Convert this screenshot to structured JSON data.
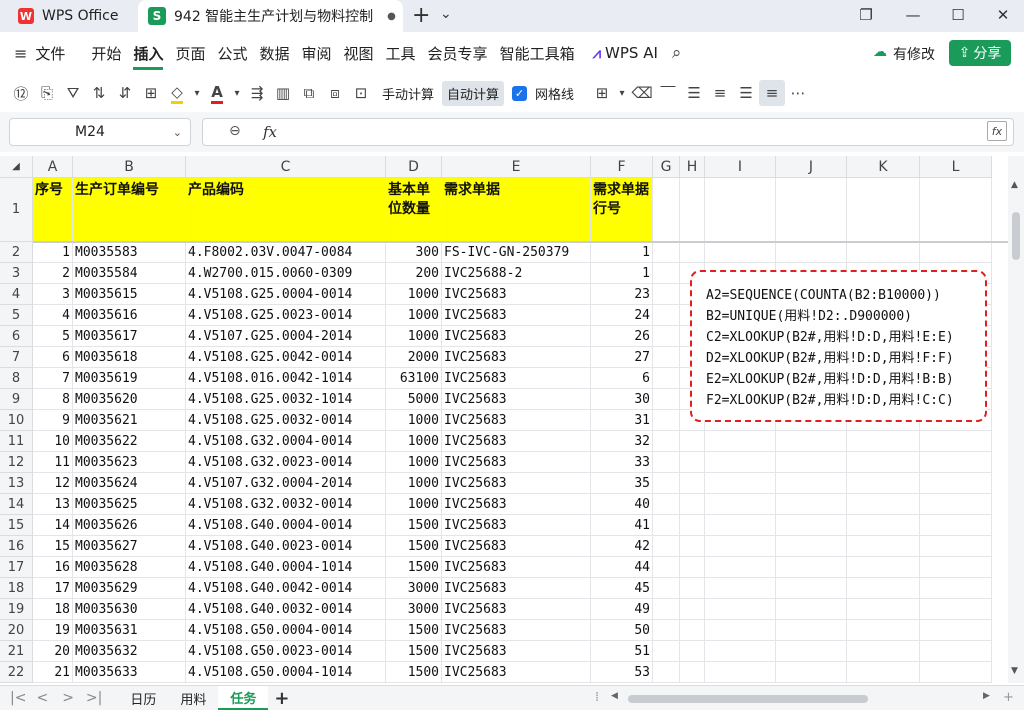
{
  "app": {
    "tab_wps": "WPS Office",
    "tab_doc": "942 智能主生产计划与物料控制",
    "tab_doc_logo": "S",
    "tab_wps_logo": "W",
    "unsaved_dot": "●",
    "new_tab": "+",
    "tab_menu": "⌄"
  },
  "menu": {
    "file": "文件",
    "items": [
      "开始",
      "插入",
      "页面",
      "公式",
      "数据",
      "审阅",
      "视图",
      "工具",
      "会员专享",
      "智能工具箱"
    ],
    "ai": "WPS AI",
    "modify": "有修改",
    "share": "分享"
  },
  "toolbar": {
    "manual_calc": "手动计算",
    "auto_calc": "自动计算",
    "gridlines": "网格线"
  },
  "formula": {
    "name_box": "M24",
    "fx": "fx",
    "value": ""
  },
  "columns": [
    "A",
    "B",
    "C",
    "D",
    "E",
    "F",
    "G",
    "H",
    "I",
    "J",
    "K",
    "L"
  ],
  "header_row": {
    "row": "1",
    "a": "序号",
    "b": "生产订单编号",
    "c": "产品编码",
    "d": "基本单位数量",
    "e": "需求单据",
    "f": "需求单据行号"
  },
  "rows": [
    {
      "r": "2",
      "a": "1",
      "b": "M0035583",
      "c": "4.F8002.03V.0047-0084",
      "d": "300",
      "e": "FS-IVC-GN-250379",
      "f": "1"
    },
    {
      "r": "3",
      "a": "2",
      "b": "M0035584",
      "c": "4.W2700.015.0060-0309",
      "d": "200",
      "e": "IVC25688-2",
      "f": "1"
    },
    {
      "r": "4",
      "a": "3",
      "b": "M0035615",
      "c": "4.V5108.G25.0004-0014",
      "d": "1000",
      "e": "IVC25683",
      "f": "23"
    },
    {
      "r": "5",
      "a": "4",
      "b": "M0035616",
      "c": "4.V5108.G25.0023-0014",
      "d": "1000",
      "e": "IVC25683",
      "f": "24"
    },
    {
      "r": "6",
      "a": "5",
      "b": "M0035617",
      "c": "4.V5107.G25.0004-2014",
      "d": "1000",
      "e": "IVC25683",
      "f": "26"
    },
    {
      "r": "7",
      "a": "6",
      "b": "M0035618",
      "c": "4.V5108.G25.0042-0014",
      "d": "2000",
      "e": "IVC25683",
      "f": "27"
    },
    {
      "r": "8",
      "a": "7",
      "b": "M0035619",
      "c": "4.V5108.016.0042-1014",
      "d": "63100",
      "e": "IVC25683",
      "f": "6"
    },
    {
      "r": "9",
      "a": "8",
      "b": "M0035620",
      "c": "4.V5108.G25.0032-1014",
      "d": "5000",
      "e": "IVC25683",
      "f": "30"
    },
    {
      "r": "10",
      "a": "9",
      "b": "M0035621",
      "c": "4.V5108.G25.0032-0014",
      "d": "1000",
      "e": "IVC25683",
      "f": "31"
    },
    {
      "r": "11",
      "a": "10",
      "b": "M0035622",
      "c": "4.V5108.G32.0004-0014",
      "d": "1000",
      "e": "IVC25683",
      "f": "32"
    },
    {
      "r": "12",
      "a": "11",
      "b": "M0035623",
      "c": "4.V5108.G32.0023-0014",
      "d": "1000",
      "e": "IVC25683",
      "f": "33"
    },
    {
      "r": "13",
      "a": "12",
      "b": "M0035624",
      "c": "4.V5107.G32.0004-2014",
      "d": "1000",
      "e": "IVC25683",
      "f": "35"
    },
    {
      "r": "14",
      "a": "13",
      "b": "M0035625",
      "c": "4.V5108.G32.0032-0014",
      "d": "1000",
      "e": "IVC25683",
      "f": "40"
    },
    {
      "r": "15",
      "a": "14",
      "b": "M0035626",
      "c": "4.V5108.G40.0004-0014",
      "d": "1500",
      "e": "IVC25683",
      "f": "41"
    },
    {
      "r": "16",
      "a": "15",
      "b": "M0035627",
      "c": "4.V5108.G40.0023-0014",
      "d": "1500",
      "e": "IVC25683",
      "f": "42"
    },
    {
      "r": "17",
      "a": "16",
      "b": "M0035628",
      "c": "4.V5108.G40.0004-1014",
      "d": "1500",
      "e": "IVC25683",
      "f": "44"
    },
    {
      "r": "18",
      "a": "17",
      "b": "M0035629",
      "c": "4.V5108.G40.0042-0014",
      "d": "3000",
      "e": "IVC25683",
      "f": "45"
    },
    {
      "r": "19",
      "a": "18",
      "b": "M0035630",
      "c": "4.V5108.G40.0032-0014",
      "d": "3000",
      "e": "IVC25683",
      "f": "49"
    },
    {
      "r": "20",
      "a": "19",
      "b": "M0035631",
      "c": "4.V5108.G50.0004-0014",
      "d": "1500",
      "e": "IVC25683",
      "f": "50"
    },
    {
      "r": "21",
      "a": "20",
      "b": "M0035632",
      "c": "4.V5108.G50.0023-0014",
      "d": "1500",
      "e": "IVC25683",
      "f": "51"
    },
    {
      "r": "22",
      "a": "21",
      "b": "M0035633",
      "c": "4.V5108.G50.0004-1014",
      "d": "1500",
      "e": "IVC25683",
      "f": "53"
    }
  ],
  "annotation": [
    "A2=SEQUENCE(COUNTA(B2:B10000))",
    "B2=UNIQUE(用料!D2:.D900000)",
    "C2=XLOOKUP(B2#,用料!D:D,用料!E:E)",
    "D2=XLOOKUP(B2#,用料!D:D,用料!F:F)",
    "E2=XLOOKUP(B2#,用料!D:D,用料!B:B)",
    "F2=XLOOKUP(B2#,用料!D:D,用料!C:C)"
  ],
  "sheets": [
    "日历",
    "用料",
    "任务"
  ],
  "sheet_add": "+",
  "colors": {
    "accent": "#1a9b5a",
    "header_fill": "#ffff00",
    "annotation_border": "#e02020"
  }
}
